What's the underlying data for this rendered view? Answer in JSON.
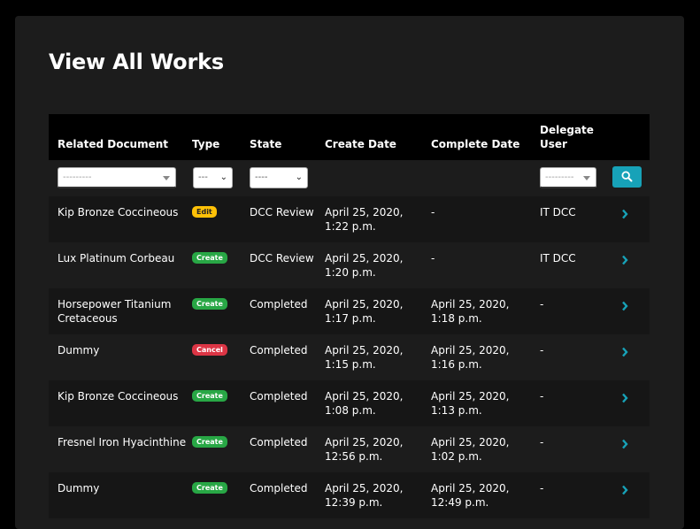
{
  "page": {
    "title": "View All Works"
  },
  "table": {
    "headers": {
      "related_document": "Related Document",
      "type": "Type",
      "state": "State",
      "create_date": "Create Date",
      "complete_date": "Complete Date",
      "delegate_user_line1": "Delegate",
      "delegate_user_line2": "User"
    },
    "filters": {
      "related_document": "---------",
      "type": "---",
      "state": "----",
      "delegate_user": "---------"
    },
    "rows": [
      {
        "document_line1": "Kip Bronze Coccineous",
        "document_line2": "",
        "type": "Edit",
        "type_style": "edit",
        "state": "DCC Review",
        "create_line1": "April 25, 2020,",
        "create_line2": "1:22 p.m.",
        "complete_line1": "-",
        "complete_line2": "",
        "delegate": "IT DCC"
      },
      {
        "document_line1": "Lux Platinum Corbeau",
        "document_line2": "",
        "type": "Create",
        "type_style": "create",
        "state": "DCC Review",
        "create_line1": "April 25, 2020,",
        "create_line2": "1:20 p.m.",
        "complete_line1": "-",
        "complete_line2": "",
        "delegate": "IT DCC"
      },
      {
        "document_line1": "Horsepower Titanium",
        "document_line2": "Cretaceous",
        "type": "Create",
        "type_style": "create",
        "state": "Completed",
        "create_line1": "April 25, 2020,",
        "create_line2": "1:17 p.m.",
        "complete_line1": "April 25, 2020,",
        "complete_line2": "1:18 p.m.",
        "delegate": "-"
      },
      {
        "document_line1": "Dummy",
        "document_line2": "",
        "type": "Cancel",
        "type_style": "cancel",
        "state": "Completed",
        "create_line1": "April 25, 2020,",
        "create_line2": "1:15 p.m.",
        "complete_line1": "April 25, 2020,",
        "complete_line2": "1:16 p.m.",
        "delegate": "-"
      },
      {
        "document_line1": "Kip Bronze Coccineous",
        "document_line2": "",
        "type": "Create",
        "type_style": "create",
        "state": "Completed",
        "create_line1": "April 25, 2020,",
        "create_line2": "1:08 p.m.",
        "complete_line1": "April 25, 2020,",
        "complete_line2": "1:13 p.m.",
        "delegate": "-"
      },
      {
        "document_line1": "Fresnel Iron Hyacinthine",
        "document_line2": "",
        "type": "Create",
        "type_style": "create",
        "state": "Completed",
        "create_line1": "April 25, 2020,",
        "create_line2": "12:56 p.m.",
        "complete_line1": "April 25, 2020,",
        "complete_line2": "1:02 p.m.",
        "delegate": "-"
      },
      {
        "document_line1": "Dummy",
        "document_line2": "",
        "type": "Create",
        "type_style": "create",
        "state": "Completed",
        "create_line1": "April 25, 2020,",
        "create_line2": "12:39 p.m.",
        "complete_line1": "April 25, 2020,",
        "complete_line2": "12:49 p.m.",
        "delegate": "-"
      }
    ]
  },
  "colors": {
    "accent": "#17a2b8",
    "badge_create": "#28a745",
    "badge_edit": "#ffc107",
    "badge_cancel": "#dc3545"
  },
  "icons": {
    "search": "search-icon",
    "row_action": "chevron-right-icon"
  }
}
